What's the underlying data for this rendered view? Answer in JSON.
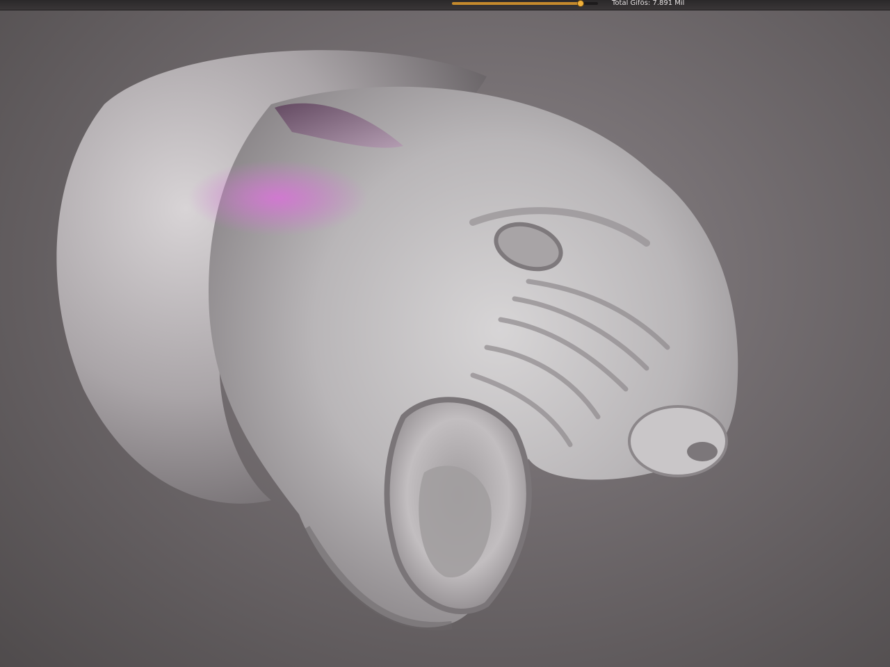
{
  "toolbar": {
    "stat_text": "Total Gifös: 7.891 Mil",
    "slider_value_fraction": 0.88,
    "accent_color": "#f0b03a"
  },
  "viewport": {
    "background_color": "#6e696b",
    "mesh_color": "#bcb8ba",
    "highlight_color": "#d873d8"
  }
}
